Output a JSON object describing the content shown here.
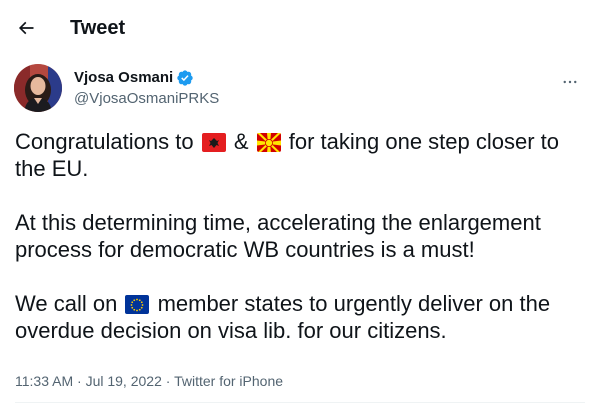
{
  "header": {
    "back_icon": "arrow-left-icon",
    "title": "Tweet"
  },
  "author": {
    "display_name": "Vjosa Osmani",
    "verified_icon": "verified-badge-icon",
    "handle": "@VjosaOsmaniPRKS",
    "more_icon": "more-horizontal-icon"
  },
  "tweet": {
    "p1_before": "Congratulations to",
    "p1_amp": "&",
    "p1_after": "for taking one step closer to the EU.",
    "flag_1": "albania-flag-icon",
    "flag_2": "north-macedonia-flag-icon",
    "p2": "At this determining time, accelerating the enlargement process for democratic WB countries is a must!",
    "p3_before": "We call on",
    "flag_3": "eu-flag-icon",
    "p3_after": "member states to urgently deliver on the overdue decision on visa lib. for our citizens."
  },
  "meta": {
    "time": "11:33 AM",
    "sep1": "·",
    "date": "Jul 19, 2022",
    "sep2": "·",
    "source": "Twitter for iPhone"
  },
  "colors": {
    "text": "#0f1419",
    "secondary": "#536471",
    "verified": "#1d9bf0",
    "divider": "#eff3f4"
  }
}
